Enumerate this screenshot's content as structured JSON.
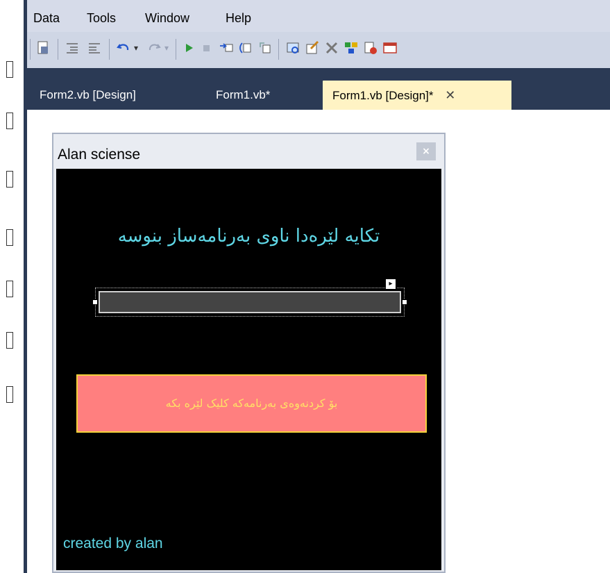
{
  "menu": {
    "items": [
      "Data",
      "Tools",
      "Window",
      "Help"
    ]
  },
  "toolbar": {
    "icons": [
      "file-properties-icon",
      "indent-icon",
      "outdent-icon",
      "undo-icon",
      "redo-icon",
      "start-icon",
      "stop-icon",
      "step-into-icon",
      "step-over-icon",
      "step-out-icon",
      "solution-explorer-icon",
      "properties-icon",
      "toolbox-icon",
      "class-view-icon",
      "error-list-icon",
      "window-icon"
    ]
  },
  "tabs": [
    {
      "label": "Form2.vb [Design]",
      "active": false
    },
    {
      "label": "Form1.vb*",
      "active": false
    },
    {
      "label": "Form1.vb [Design]*",
      "active": true,
      "close": "✕"
    }
  ],
  "form": {
    "title": "Alan sciense",
    "close": "×",
    "heading": "تکایە لێرەدا ناوی بەرنامەساز بنوسە",
    "textbox_value": "",
    "smart_tag": "▸",
    "button_label": "بۆ کردنەوەی بەرنامەکە کلیک لێرە بکە",
    "footer": "created by alan"
  },
  "colors": {
    "menubar": "#d6dbe9",
    "tabbar": "#2b3a55",
    "active_tab": "#fff3c4",
    "form_client": "#000000",
    "heading_text": "#5fd7e6",
    "button_bg": "#ff7f7f",
    "button_border": "#f5d23a",
    "button_text": "#ffe066"
  }
}
